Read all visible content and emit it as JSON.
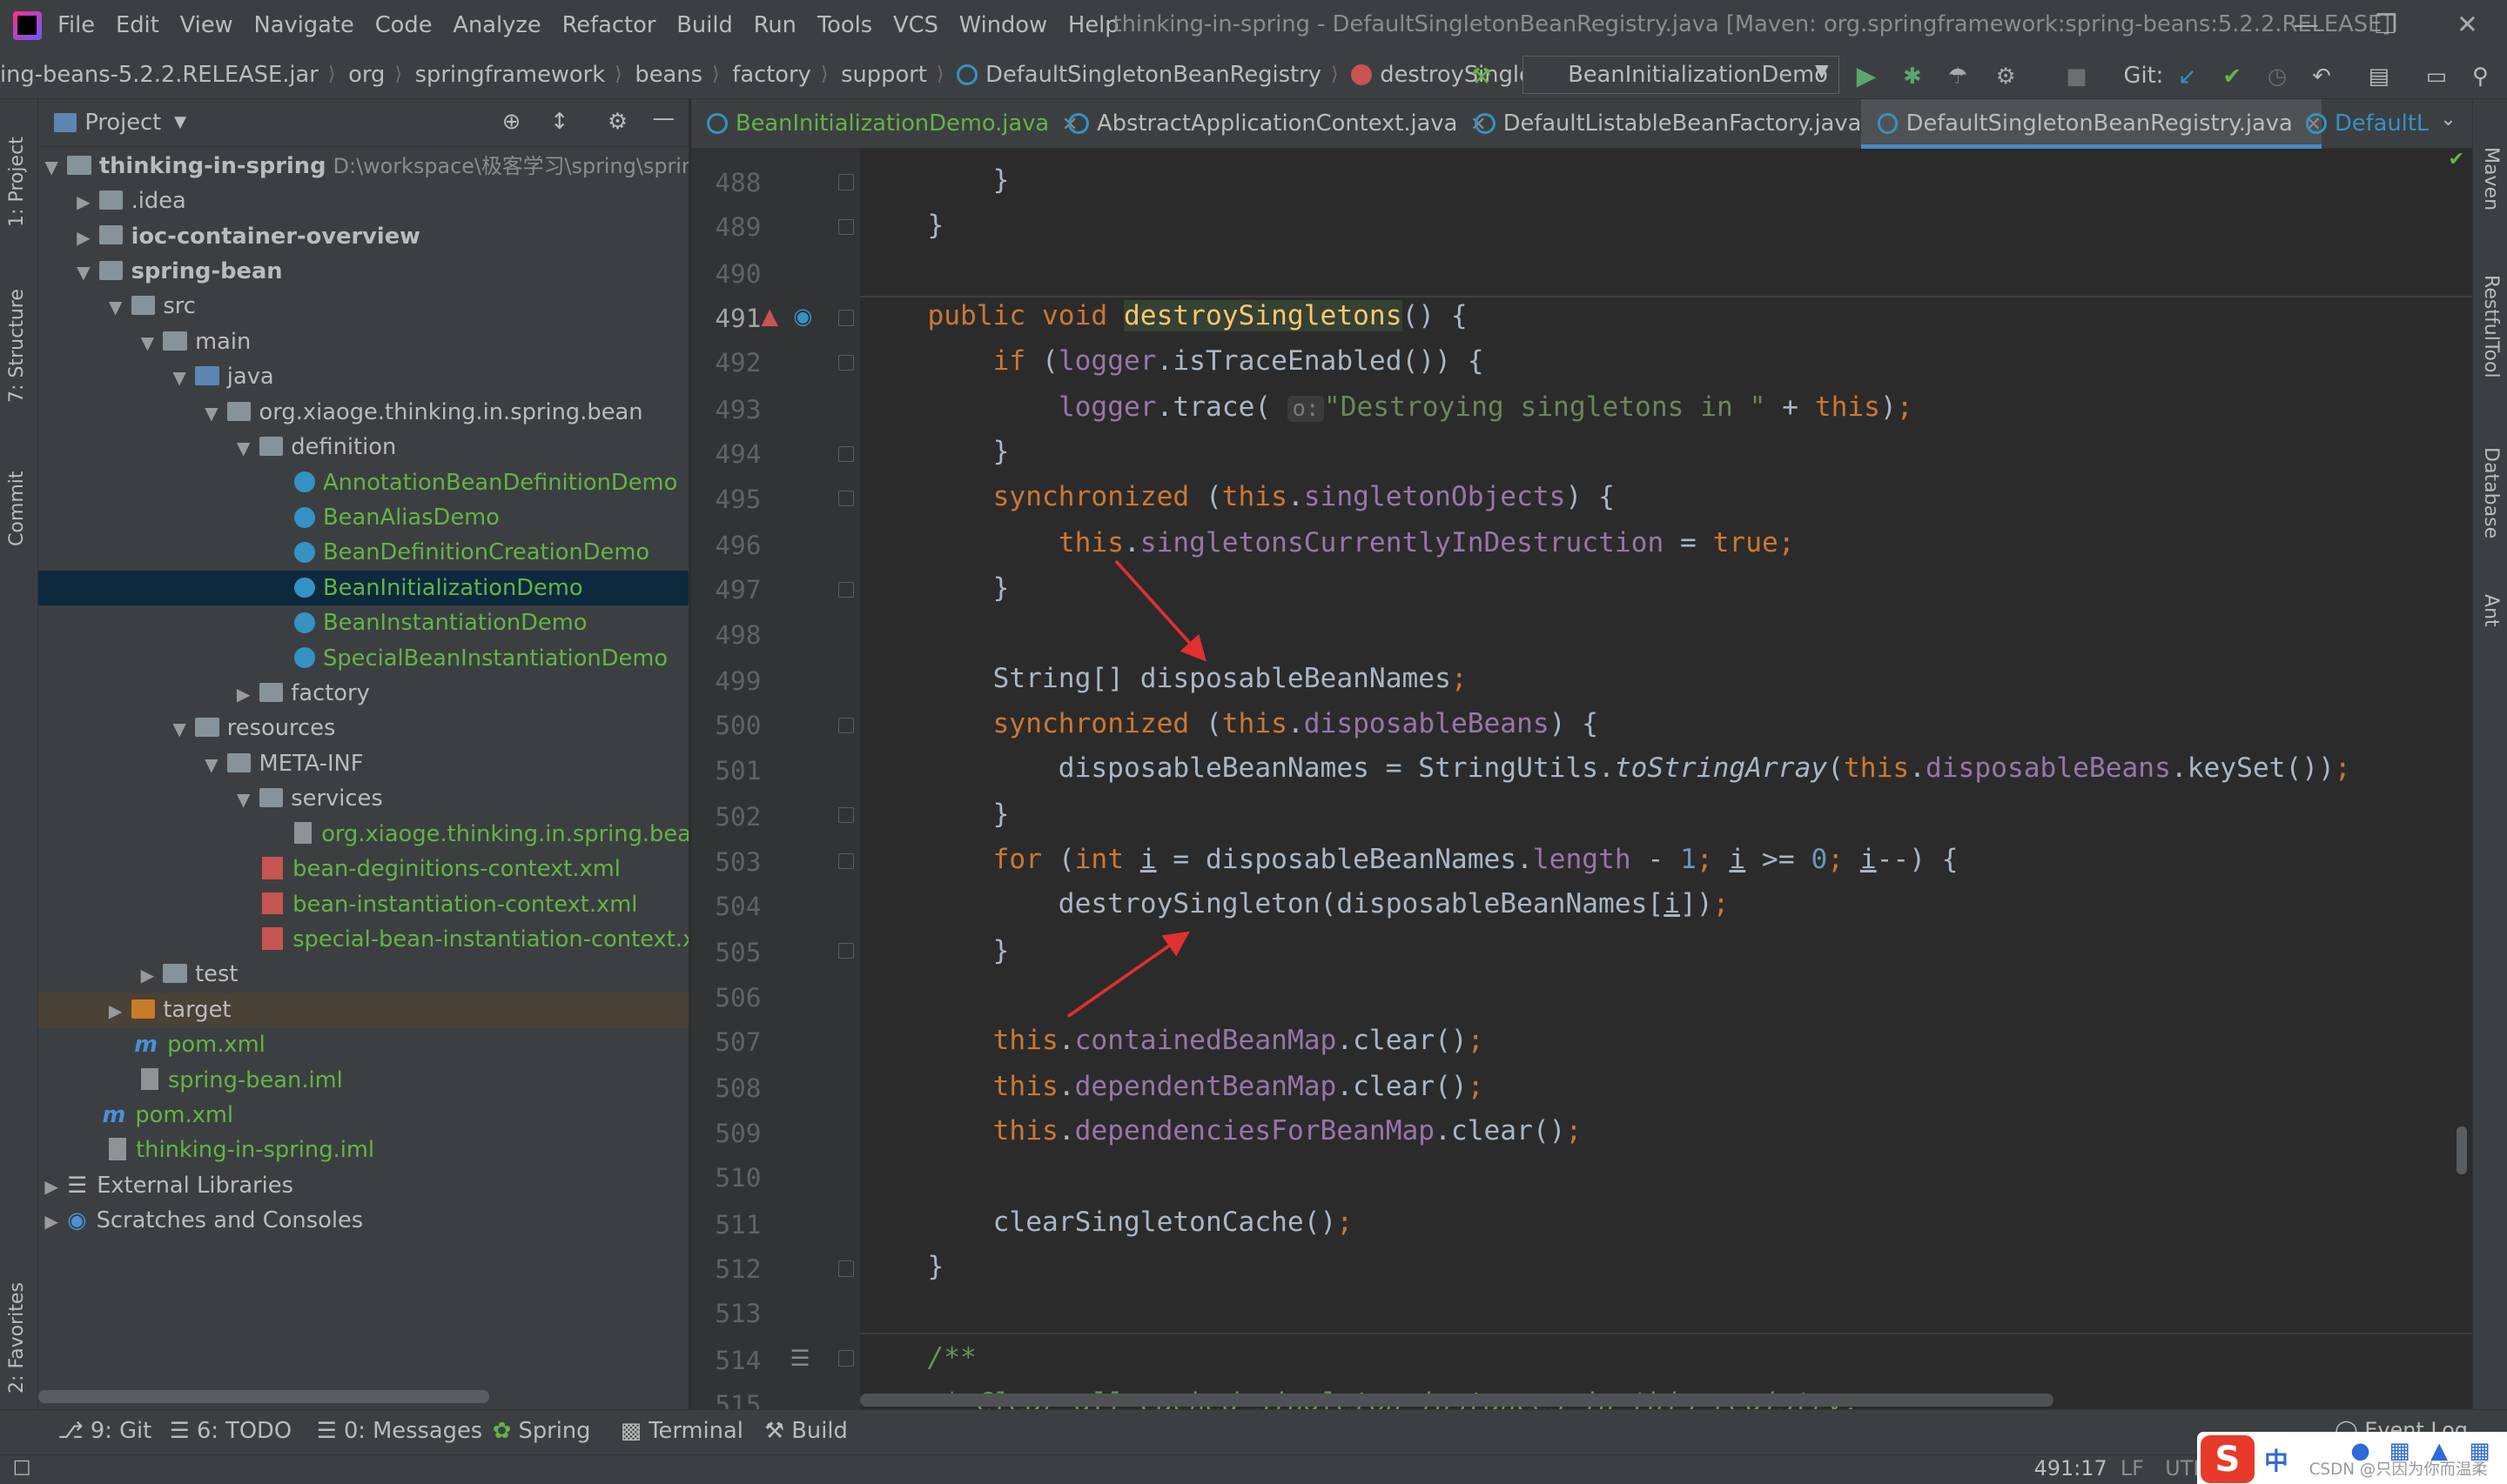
{
  "menu": [
    "File",
    "Edit",
    "View",
    "Navigate",
    "Code",
    "Analyze",
    "Refactor",
    "Build",
    "Run",
    "Tools",
    "VCS",
    "Window",
    "Help"
  ],
  "window_title": "thinking-in-spring - DefaultSingletonBeanRegistry.java [Maven: org.springframework:spring-beans:5.2.2.RELEASE]",
  "breadcrumbs": [
    "ing-beans-5.2.2.RELEASE.jar",
    "org",
    "springframework",
    "beans",
    "factory",
    "support",
    "DefaultSingletonBeanRegistry",
    "destroySingletons"
  ],
  "run_config": "BeanInitializationDemo",
  "git_label": "Git:",
  "project_panel": {
    "title": "Project",
    "tree": [
      {
        "label": "thinking-in-spring",
        "path": "D:\\workspace\\极客学习\\spring\\spring-"
      },
      {
        "label": ".idea"
      },
      {
        "label": "ioc-container-overview"
      },
      {
        "label": "spring-bean"
      },
      {
        "label": "src"
      },
      {
        "label": "main"
      },
      {
        "label": "java"
      },
      {
        "label": "org.xiaoge.thinking.in.spring.bean"
      },
      {
        "label": "definition"
      },
      {
        "label": "AnnotationBeanDefinitionDemo"
      },
      {
        "label": "BeanAliasDemo"
      },
      {
        "label": "BeanDefinitionCreationDemo"
      },
      {
        "label": "BeanInitializationDemo"
      },
      {
        "label": "BeanInstantiationDemo"
      },
      {
        "label": "SpecialBeanInstantiationDemo"
      },
      {
        "label": "factory"
      },
      {
        "label": "resources"
      },
      {
        "label": "META-INF"
      },
      {
        "label": "services"
      },
      {
        "label": "org.xiaoge.thinking.in.spring.bean.fa"
      },
      {
        "label": "bean-deginitions-context.xml"
      },
      {
        "label": "bean-instantiation-context.xml"
      },
      {
        "label": "special-bean-instantiation-context.xml"
      },
      {
        "label": "test"
      },
      {
        "label": "target"
      },
      {
        "label": "pom.xml"
      },
      {
        "label": "spring-bean.iml"
      },
      {
        "label": "pom.xml"
      },
      {
        "label": "thinking-in-spring.iml"
      },
      {
        "label": "External Libraries"
      },
      {
        "label": "Scratches and Consoles"
      }
    ]
  },
  "tabs": [
    "BeanInitializationDemo.java",
    "AbstractApplicationContext.java",
    "DefaultListableBeanFactory.java",
    "DefaultSingletonBeanRegistry.java",
    "DefaultL"
  ],
  "line_numbers": [
    "488",
    "489",
    "490",
    "491",
    "492",
    "493",
    "494",
    "495",
    "496",
    "497",
    "498",
    "499",
    "500",
    "501",
    "502",
    "503",
    "504",
    "505",
    "506",
    "507",
    "508",
    "509",
    "510",
    "511",
    "512",
    "513",
    "514",
    "515"
  ],
  "code": {
    "hint": "o:",
    "trace_str": "\"Destroying singletons in \"",
    "comment1": "/**",
    "comment2": " * Clear all cached singleton instances in this registry."
  },
  "left_tabs": [
    "1: Project",
    "7: Structure",
    "Commit",
    "2: Favorites"
  ],
  "right_tabs": [
    "Maven",
    "RestfulTool",
    "Database",
    "Ant"
  ],
  "bottom_tabs": [
    "9: Git",
    "6: TODO",
    "0: Messages",
    "Spring",
    "Terminal",
    "Build"
  ],
  "event_log": "Event Log",
  "status": {
    "position": "491:17",
    "line_sep": "LF",
    "encoding": "UTF"
  },
  "ime": {
    "lang": "中",
    "watermark": "CSDN @只因为你而温柔"
  }
}
